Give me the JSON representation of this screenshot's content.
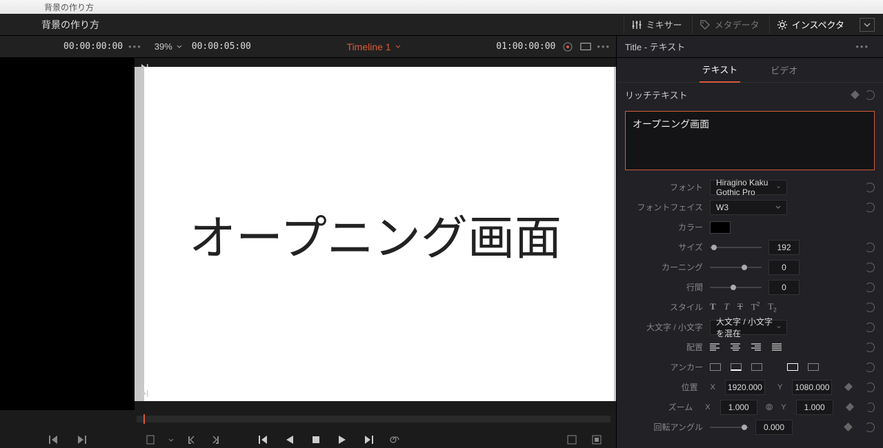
{
  "titlebar": {
    "title": "背景の作り方"
  },
  "toolbar": {
    "project": "背景の作り方",
    "mixer": "ミキサー",
    "metadata": "メタデータ",
    "inspector": "インスペクタ"
  },
  "timelineBar": {
    "tc_in": "00:00:00:00",
    "zoom": "39%",
    "tc_dur": "00:00:05:00",
    "name": "Timeline 1",
    "tc_pos": "01:00:00:00"
  },
  "canvas": {
    "text": "オープニング画面"
  },
  "inspector": {
    "title": "Title - テキスト",
    "tabs": {
      "text": "テキスト",
      "video": "ビデオ"
    },
    "section": "リッチテキスト",
    "textValue": "オープニング画面",
    "font": {
      "label": "フォント",
      "value": "Hiragino Kaku Gothic Pro"
    },
    "face": {
      "label": "フォントフェイス",
      "value": "W3"
    },
    "color": {
      "label": "カラー"
    },
    "size": {
      "label": "サイズ",
      "value": "192"
    },
    "kerning": {
      "label": "カーニング",
      "value": "0"
    },
    "leading": {
      "label": "行間",
      "value": "0"
    },
    "style": {
      "label": "スタイル"
    },
    "case": {
      "label": "大文字 / 小文字",
      "value": "大文字 / 小文字を混在"
    },
    "align": {
      "label": "配置"
    },
    "anchor": {
      "label": "アンカー"
    },
    "position": {
      "label": "位置",
      "x": "1920.000",
      "y": "1080.000"
    },
    "zoomp": {
      "label": "ズーム",
      "x": "1.000",
      "y": "1.000"
    },
    "rotation": {
      "label": "回転アングル",
      "value": "0.000"
    }
  }
}
